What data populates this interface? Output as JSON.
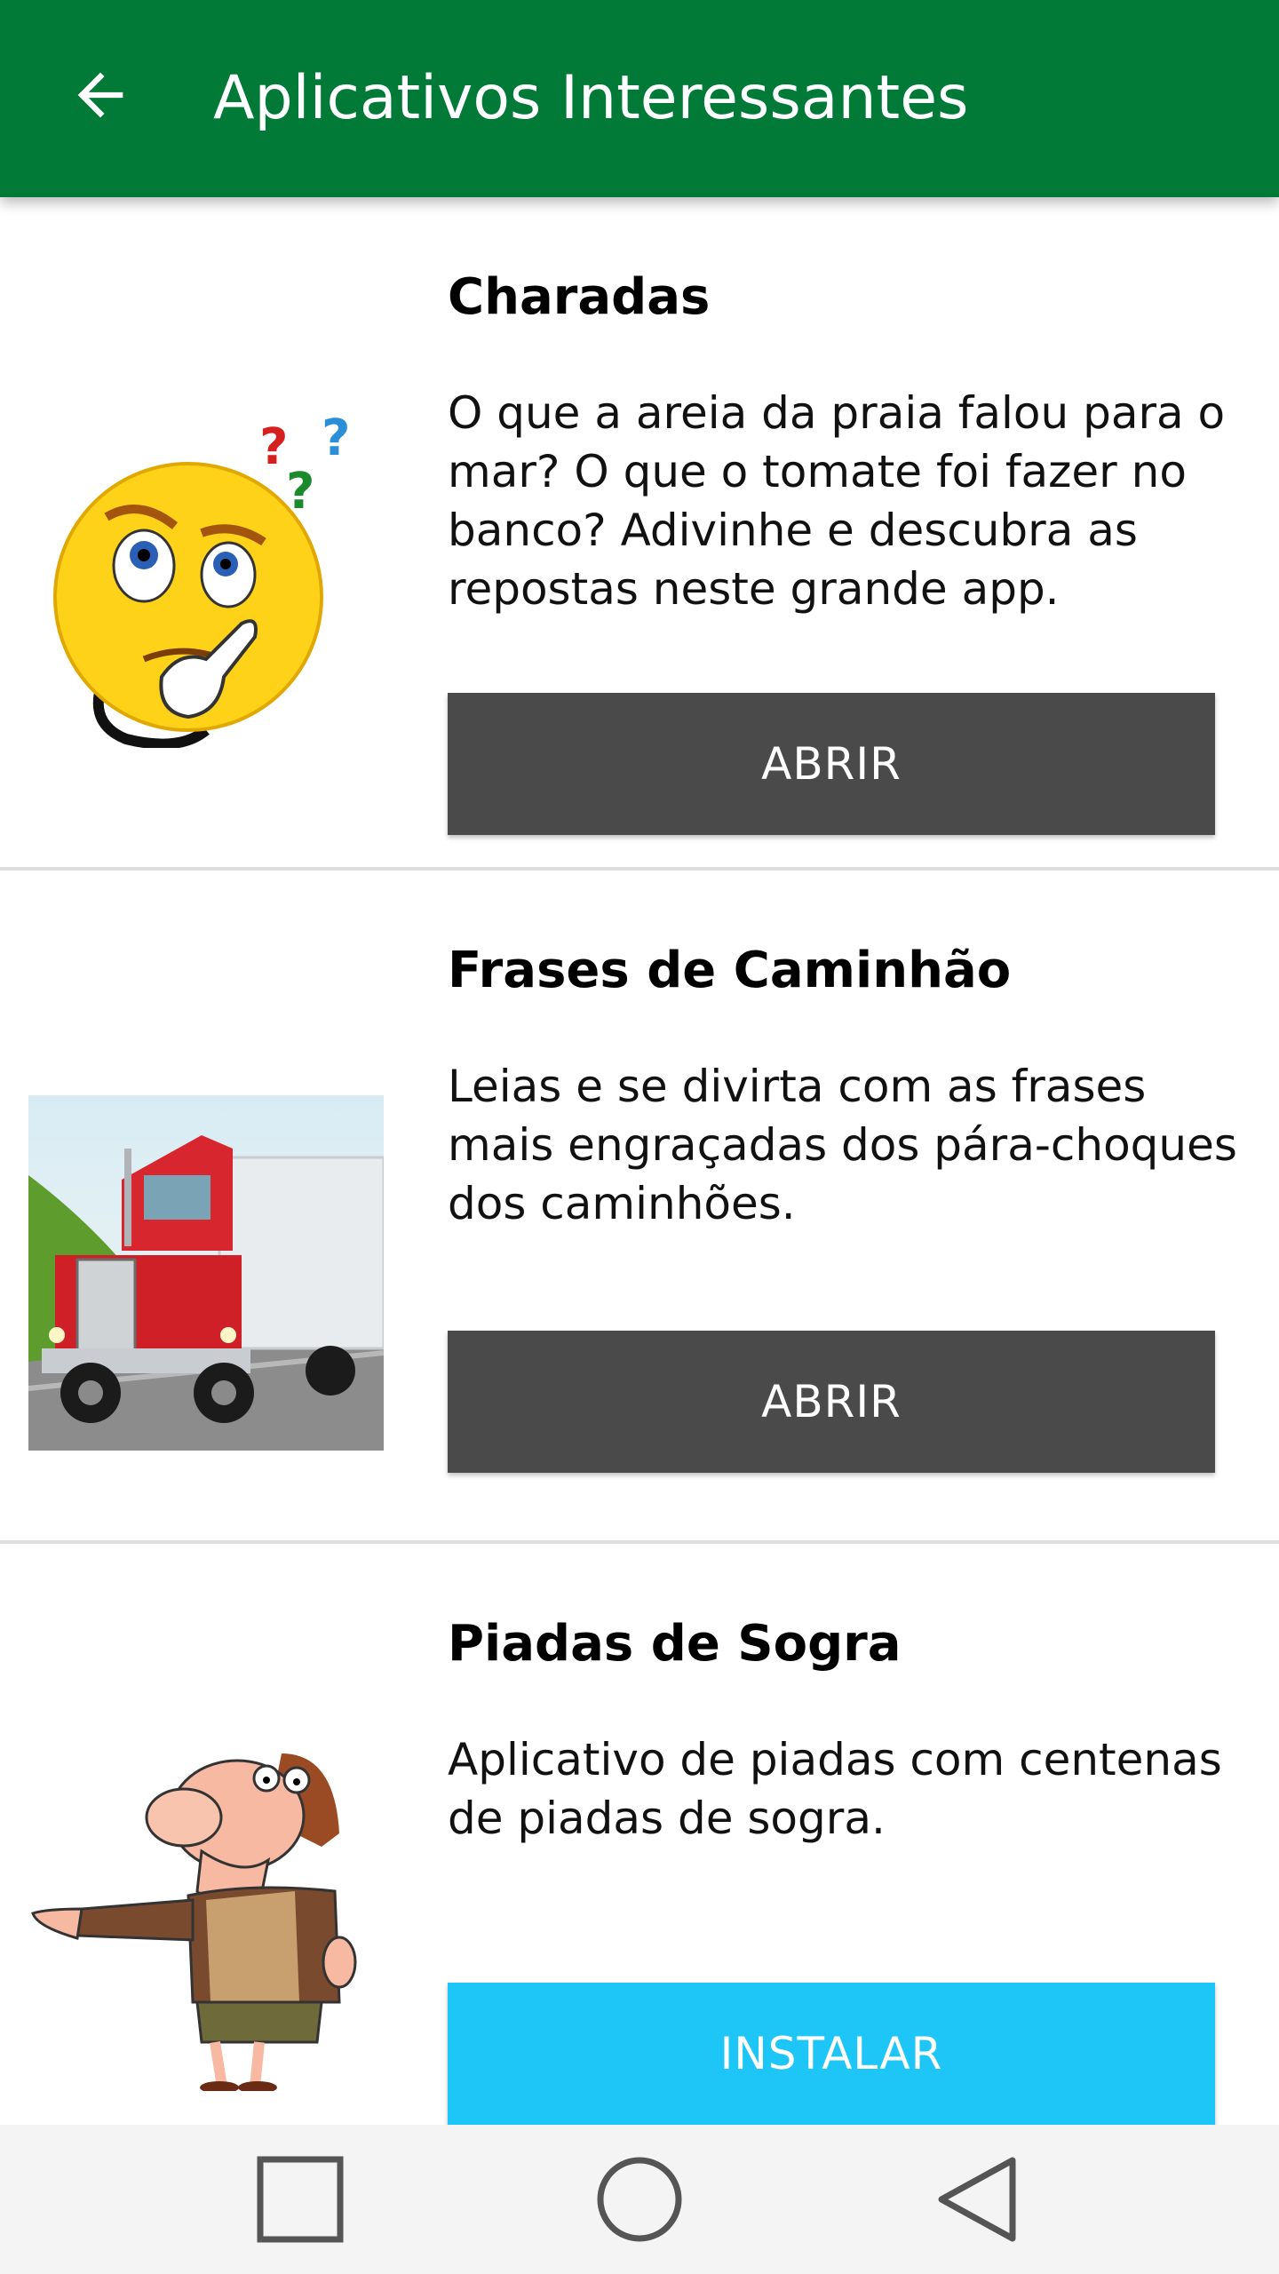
{
  "appbar": {
    "title": "Aplicativos Interessantes",
    "color": "#007a36"
  },
  "apps": [
    {
      "name": "Charadas",
      "description": "O que a areia da praia falou para o mar? O que o tomate foi fazer no banco? Adivinhe e descubra as repostas neste grande app.",
      "button_label": "ABRIR",
      "button_color": "#4a4a4a",
      "icon": "thinking-emoji-icon"
    },
    {
      "name": "Frases de Caminhão",
      "description": "Leias e se divirta com as frases mais engraçadas dos pára-choques dos caminhões.",
      "button_label": "ABRIR",
      "button_color": "#4a4a4a",
      "icon": "red-truck-image"
    },
    {
      "name": "Piadas de Sogra",
      "description": "Aplicativo de piadas com centenas de piadas de sogra.",
      "button_label": "INSTALAR",
      "button_color": "#1ec6f7",
      "icon": "mother-in-law-cartoon"
    }
  ],
  "navbar": {
    "icons": [
      "recent-apps-icon",
      "home-icon",
      "back-icon"
    ]
  }
}
